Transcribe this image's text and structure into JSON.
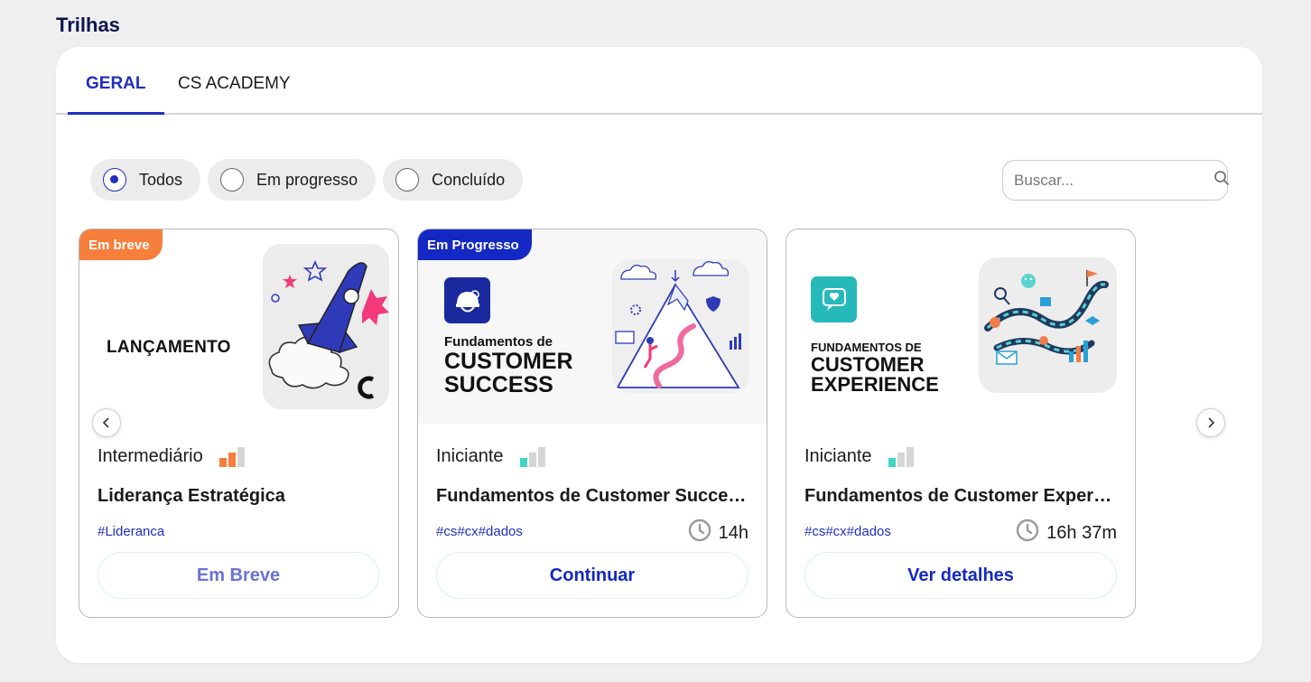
{
  "page": {
    "section_title": "Trilhas"
  },
  "tabs": [
    {
      "label": "GERAL",
      "active": true
    },
    {
      "label": "CS ACADEMY",
      "active": false
    }
  ],
  "filters": [
    {
      "label": "Todos",
      "selected": true
    },
    {
      "label": "Em progresso",
      "selected": false
    },
    {
      "label": "Concluído",
      "selected": false
    }
  ],
  "search": {
    "placeholder": "Buscar...",
    "icon": "search-icon"
  },
  "colors": {
    "accent": "#1f2fbf",
    "badge_coming_soon": "#f77f3c",
    "badge_in_progress": "#1428c4",
    "level_intermediate": "#f77f3c",
    "level_beginner": "#3fd6c6"
  },
  "cards": [
    {
      "badge": "Em breve",
      "banner_text": "LANÇAMENTO",
      "level": "Intermediário",
      "level_filled": 2,
      "title": "Liderança Estratégica",
      "tags": "#Lideranca",
      "duration": "",
      "cta": "Em Breve"
    },
    {
      "badge": "Em Progresso",
      "banner_line1": "Fundamentos de",
      "banner_line2": "CUSTOMER",
      "banner_line3": "SUCCESS",
      "level": "Iniciante",
      "level_filled": 1,
      "title": "Fundamentos de Customer Success",
      "tags": "#cs#cx#dados",
      "duration": "14h",
      "cta": "Continuar"
    },
    {
      "badge": "",
      "banner_line1": "FUNDAMENTOS DE",
      "banner_line2": "CUSTOMER",
      "banner_line3": "EXPERIENCE",
      "level": "Iniciante",
      "level_filled": 1,
      "title": "Fundamentos de Customer Experience",
      "tags": "#cs#cx#dados",
      "duration": "16h 37m",
      "cta": "Ver detalhes"
    }
  ]
}
